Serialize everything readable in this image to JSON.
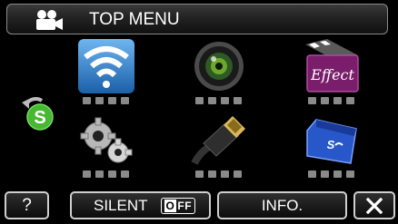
{
  "title": "TOP MENU",
  "icons": {
    "mode": "video-camera-icon",
    "side": "return-to-original-icon",
    "tiles": [
      "wireless-icon",
      "camera-lens-icon",
      "effect-clapper-icon",
      "settings-gears-icon",
      "hdmi-cable-icon",
      "sd-card-icon"
    ]
  },
  "buttons": {
    "help": "?",
    "silent": "SILENT",
    "silent_state": "OFF",
    "info": "INFO.",
    "close": "close-icon"
  },
  "colors": {
    "background": "#000000",
    "button_border": "#cfcfcf",
    "side_icon_green": "#46b832",
    "wireless_blue": "#2a7dc9",
    "sd_blue": "#2857c9"
  }
}
